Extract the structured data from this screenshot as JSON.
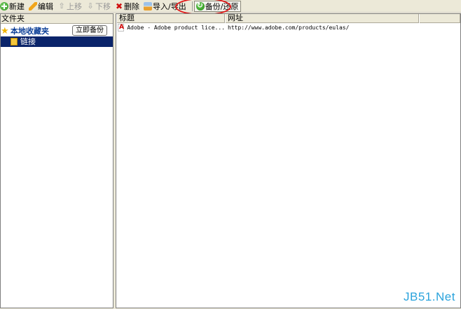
{
  "toolbar": {
    "new_label": "新建",
    "edit_label": "编辑",
    "up_label": "上移",
    "down_label": "下移",
    "delete_label": "删除",
    "import_export_label": "导入/导出",
    "backup_restore_label": "备份/还原"
  },
  "folders": {
    "header": "文件夹",
    "root_label": "本地收藏夹",
    "backup_now_label": "立即备份",
    "child_label": "链接"
  },
  "list": {
    "col_title": "标题",
    "col_url": "网址",
    "rows": [
      {
        "title": "Adobe - Adobe product lice...",
        "url": "http://www.adobe.com/products/eulas/"
      }
    ]
  },
  "watermark": "JB51.Net",
  "colors": {
    "highlight_ring": "#e01818",
    "selection": "#0a246a",
    "root_text": "#0b3e97"
  }
}
